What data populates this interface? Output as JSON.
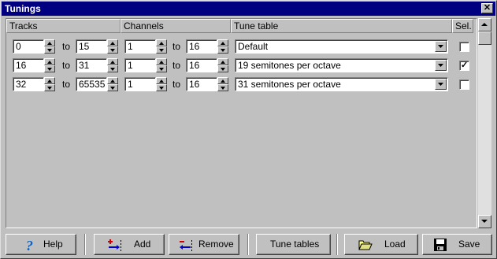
{
  "window": {
    "title": "Tunings",
    "close_label": "✕"
  },
  "columns": {
    "tracks": "Tracks",
    "channels": "Channels",
    "tune_table": "Tune table",
    "sel": "Sel."
  },
  "to_label": "to",
  "rows": [
    {
      "track_from": "0",
      "track_to": "15",
      "ch_from": "1",
      "ch_to": "16",
      "table": "Default",
      "sel": false
    },
    {
      "track_from": "16",
      "track_to": "31",
      "ch_from": "1",
      "ch_to": "16",
      "table": "19 semitones per octave",
      "sel": true
    },
    {
      "track_from": "32",
      "track_to": "65535",
      "ch_from": "1",
      "ch_to": "16",
      "table": "31 semitones per octave",
      "sel": false
    }
  ],
  "checkmark": "✓",
  "buttons": {
    "help": "Help",
    "add": "Add",
    "remove": "Remove",
    "tune_tables": "Tune tables",
    "load": "Load",
    "save": "Save"
  },
  "colors": {
    "titlebar": "#000080",
    "face": "#c0c0c0",
    "help_icon": "#0a64c8",
    "add_red": "#d00000",
    "add_blue": "#0000c8"
  }
}
